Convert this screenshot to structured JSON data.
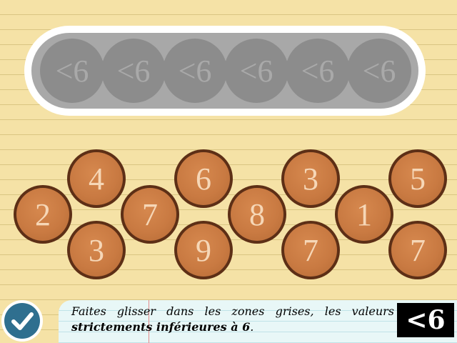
{
  "slots": [
    {
      "label": "<6"
    },
    {
      "label": "<6"
    },
    {
      "label": "<6"
    },
    {
      "label": "<6"
    },
    {
      "label": "<6"
    },
    {
      "label": "<6"
    }
  ],
  "tokens": [
    {
      "value": "2"
    },
    {
      "value": "4"
    },
    {
      "value": "3"
    },
    {
      "value": "7"
    },
    {
      "value": "6"
    },
    {
      "value": "9"
    },
    {
      "value": "8"
    },
    {
      "value": "3"
    },
    {
      "value": "7"
    },
    {
      "value": "1"
    },
    {
      "value": "5"
    },
    {
      "value": "7"
    }
  ],
  "instruction": {
    "text": "Faites glisser dans les zones grises, les valeurs",
    "bold": "strictements inférieures à 6",
    "end": "."
  },
  "badge": {
    "label": "<6"
  },
  "colors": {
    "background": "#f5e2a6",
    "token": "#c97a42",
    "slot": "#8c8c8c",
    "check_button": "#2f6f8f"
  },
  "icons": {
    "check_button": "checkmark-icon"
  }
}
